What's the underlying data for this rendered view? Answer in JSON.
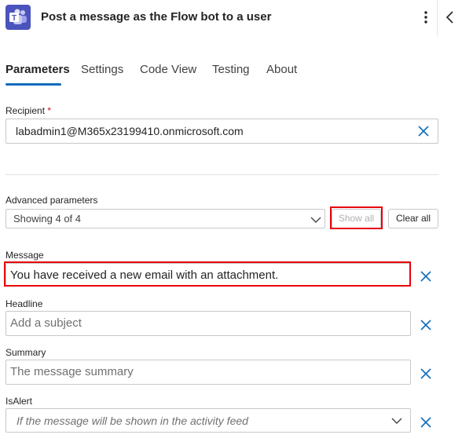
{
  "header": {
    "title": "Post a message as the Flow bot to a user",
    "app_icon": "microsoft-teams-icon"
  },
  "tabs": [
    {
      "label": "Parameters",
      "active": true
    },
    {
      "label": "Settings",
      "active": false
    },
    {
      "label": "Code View",
      "active": false
    },
    {
      "label": "Testing",
      "active": false
    },
    {
      "label": "About",
      "active": false
    }
  ],
  "recipient": {
    "label": "Recipient",
    "required_marker": "*",
    "value": "labadmin1@M365x23199410.onmicrosoft.com"
  },
  "advanced": {
    "label": "Advanced parameters",
    "selected": "Showing 4 of 4",
    "show_all_label": "Show all",
    "clear_all_label": "Clear all"
  },
  "message": {
    "label": "Message",
    "value": "You have received a new email with an attachment."
  },
  "headline": {
    "label": "Headline",
    "placeholder": "Add a subject"
  },
  "summary": {
    "label": "Summary",
    "placeholder": "The message summary"
  },
  "isalert": {
    "label": "IsAlert",
    "placeholder": "If the message will be shown in the activity feed"
  },
  "colors": {
    "accent": "#0f6cbd",
    "teams_purple": "#4b53bc",
    "highlight": "#e8000b",
    "required": "#c50f1f"
  }
}
